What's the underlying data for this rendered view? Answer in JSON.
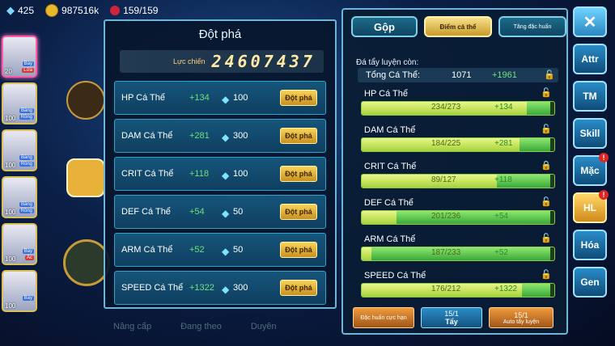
{
  "topbar": {
    "gems": "425",
    "gold": "987516k",
    "stamina": "159/159"
  },
  "roster": [
    {
      "level": "20",
      "tags": [
        "Bay",
        "Lửa"
      ],
      "active": true
    },
    {
      "level": "100",
      "tags": [
        "Băng",
        "Rồng"
      ],
      "active": false
    },
    {
      "level": "100",
      "tags": [
        "Băng",
        "Rồng"
      ],
      "active": false
    },
    {
      "level": "100",
      "tags": [
        "Băng",
        "Rồng"
      ],
      "active": false
    },
    {
      "level": "100",
      "tags": [
        "Bay",
        "Ác"
      ],
      "active": false
    },
    {
      "level": "100",
      "tags": [
        "Bay",
        ""
      ],
      "active": false
    }
  ],
  "bottom_nav": [
    "Nâng cấp",
    "Đang theo",
    "Duyên"
  ],
  "breakthrough": {
    "title": "Đột phá",
    "power_label": "Lực chiến",
    "power_value": "24607437",
    "button_label": "Đột phá",
    "rows": [
      {
        "name": "HP Cá Thể",
        "delta": "+134",
        "cost": "100"
      },
      {
        "name": "DAM Cá Thể",
        "delta": "+281",
        "cost": "300"
      },
      {
        "name": "CRIT Cá Thể",
        "delta": "+118",
        "cost": "100"
      },
      {
        "name": "DEF Cá Thể",
        "delta": "+54",
        "cost": "50"
      },
      {
        "name": "ARM Cá Thể",
        "delta": "+52",
        "cost": "50"
      },
      {
        "name": "SPEED Cá Thể",
        "delta": "+1322",
        "cost": "300"
      }
    ]
  },
  "panel": {
    "tabs": [
      "Gộp",
      "Điểm cá thể",
      "Tăng đặc huấn"
    ],
    "section_title": "Đá tẩy luyện còn:",
    "total": {
      "label": "Tổng Cá Thể:",
      "value": "1071",
      "bonus": "+1961"
    },
    "stats": [
      {
        "name": "HP Cá Thể",
        "current": "234/273",
        "bonus": "+134",
        "fill": 0.857,
        "bonus_fill": 0.98
      },
      {
        "name": "DAM Cá Thể",
        "current": "184/225",
        "bonus": "+281",
        "fill": 0.818,
        "bonus_fill": 0.98
      },
      {
        "name": "CRIT Cá Thể",
        "current": "89/127",
        "bonus": "+118",
        "fill": 0.7,
        "bonus_fill": 0.98
      },
      {
        "name": "DEF Cá Thể",
        "current": "201/236",
        "bonus": "+54",
        "fill": 0.18,
        "bonus_fill": 0.98
      },
      {
        "name": "ARM Cá Thể",
        "current": "187/233",
        "bonus": "+52",
        "fill": 0.05,
        "bonus_fill": 0.98
      },
      {
        "name": "SPEED Cá Thể",
        "current": "176/212",
        "bonus": "+1322",
        "fill": 0.83,
        "bonus_fill": 0.98
      }
    ],
    "buttons": {
      "special": "Đặc huấn cực hạn",
      "wash_count": "15/1",
      "wash_label": "Tẩy",
      "auto_count": "15/1",
      "auto_label": "Auto tẩy luyện"
    }
  },
  "side_buttons": [
    {
      "label": "✕",
      "alert": false
    },
    {
      "label": "Attr",
      "alert": false
    },
    {
      "label": "TM",
      "alert": false
    },
    {
      "label": "Skill",
      "alert": false
    },
    {
      "label": "Mặc",
      "alert": true
    },
    {
      "label": "HL",
      "alert": true
    },
    {
      "label": "Hóa",
      "alert": false
    },
    {
      "label": "Gen",
      "alert": false
    }
  ]
}
